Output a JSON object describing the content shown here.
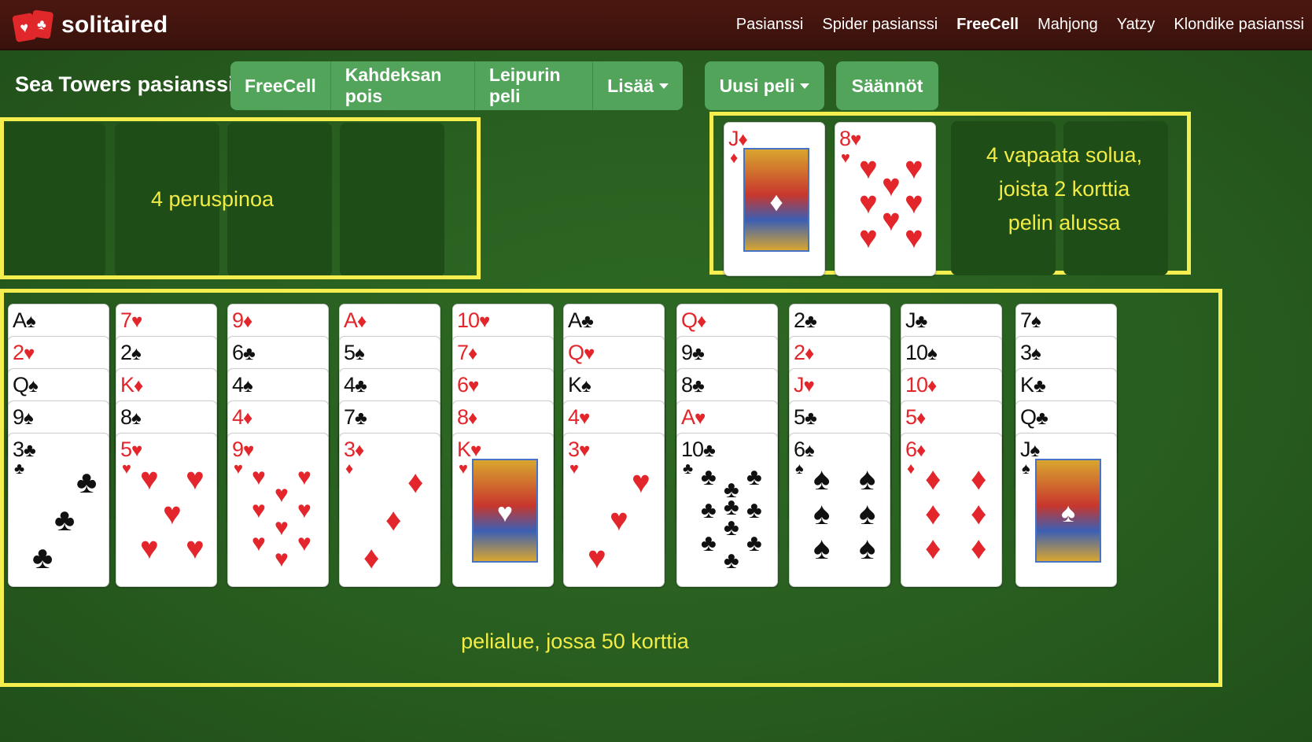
{
  "brand": {
    "name": "solitaired",
    "logo_suits": [
      "♥",
      "♣"
    ]
  },
  "nav": {
    "items": [
      "Pasianssi",
      "Spider pasianssi",
      "FreeCell",
      "Mahjong",
      "Yatzy",
      "Klondike pasianssi"
    ],
    "active": "FreeCell"
  },
  "page_title": "Sea Towers pasianssi",
  "game_menu": {
    "items": [
      "FreeCell",
      "Kahdeksan pois",
      "Leipurin peli",
      "Lisää"
    ]
  },
  "new_game_label": "Uusi peli",
  "rules_label": "Säännöt",
  "annotations": {
    "foundations": "4 peruspinoa",
    "freecells": [
      "4 vapaata solua,",
      "joista 2 korttia",
      "pelin alussa"
    ],
    "tableau": "pelialue, jossa 50 korttia"
  },
  "colors": {
    "topbar": "#3a120c",
    "felt": "#285e1f",
    "button": "#51a45a",
    "highlight": "#f4ee4e",
    "red_suit": "#e2262b"
  },
  "freecells": [
    {
      "rank": "J",
      "suit": "♦"
    },
    {
      "rank": "8",
      "suit": "♥"
    }
  ],
  "tableau": [
    [
      {
        "rank": "A",
        "suit": "♠"
      },
      {
        "rank": "2",
        "suit": "♥"
      },
      {
        "rank": "Q",
        "suit": "♠"
      },
      {
        "rank": "9",
        "suit": "♠"
      },
      {
        "rank": "3",
        "suit": "♣"
      }
    ],
    [
      {
        "rank": "7",
        "suit": "♥"
      },
      {
        "rank": "2",
        "suit": "♠"
      },
      {
        "rank": "K",
        "suit": "♦"
      },
      {
        "rank": "8",
        "suit": "♠"
      },
      {
        "rank": "5",
        "suit": "♥"
      }
    ],
    [
      {
        "rank": "9",
        "suit": "♦"
      },
      {
        "rank": "6",
        "suit": "♣"
      },
      {
        "rank": "4",
        "suit": "♠"
      },
      {
        "rank": "4",
        "suit": "♦"
      },
      {
        "rank": "9",
        "suit": "♥"
      }
    ],
    [
      {
        "rank": "A",
        "suit": "♦"
      },
      {
        "rank": "5",
        "suit": "♠"
      },
      {
        "rank": "4",
        "suit": "♣"
      },
      {
        "rank": "7",
        "suit": "♣"
      },
      {
        "rank": "3",
        "suit": "♦"
      }
    ],
    [
      {
        "rank": "10",
        "suit": "♥"
      },
      {
        "rank": "7",
        "suit": "♦"
      },
      {
        "rank": "6",
        "suit": "♥"
      },
      {
        "rank": "8",
        "suit": "♦"
      },
      {
        "rank": "K",
        "suit": "♥"
      }
    ],
    [
      {
        "rank": "A",
        "suit": "♣"
      },
      {
        "rank": "Q",
        "suit": "♥"
      },
      {
        "rank": "K",
        "suit": "♠"
      },
      {
        "rank": "4",
        "suit": "♥"
      },
      {
        "rank": "3",
        "suit": "♥"
      }
    ],
    [
      {
        "rank": "Q",
        "suit": "♦"
      },
      {
        "rank": "9",
        "suit": "♣"
      },
      {
        "rank": "8",
        "suit": "♣"
      },
      {
        "rank": "A",
        "suit": "♥"
      },
      {
        "rank": "10",
        "suit": "♣"
      }
    ],
    [
      {
        "rank": "2",
        "suit": "♣"
      },
      {
        "rank": "2",
        "suit": "♦"
      },
      {
        "rank": "J",
        "suit": "♥"
      },
      {
        "rank": "5",
        "suit": "♣"
      },
      {
        "rank": "6",
        "suit": "♠"
      }
    ],
    [
      {
        "rank": "J",
        "suit": "♣"
      },
      {
        "rank": "10",
        "suit": "♠"
      },
      {
        "rank": "10",
        "suit": "♦"
      },
      {
        "rank": "5",
        "suit": "♦"
      },
      {
        "rank": "6",
        "suit": "♦"
      }
    ],
    [
      {
        "rank": "7",
        "suit": "♠"
      },
      {
        "rank": "3",
        "suit": "♠"
      },
      {
        "rank": "K",
        "suit": "♣"
      },
      {
        "rank": "Q",
        "suit": "♣"
      },
      {
        "rank": "J",
        "suit": "♠"
      }
    ]
  ]
}
